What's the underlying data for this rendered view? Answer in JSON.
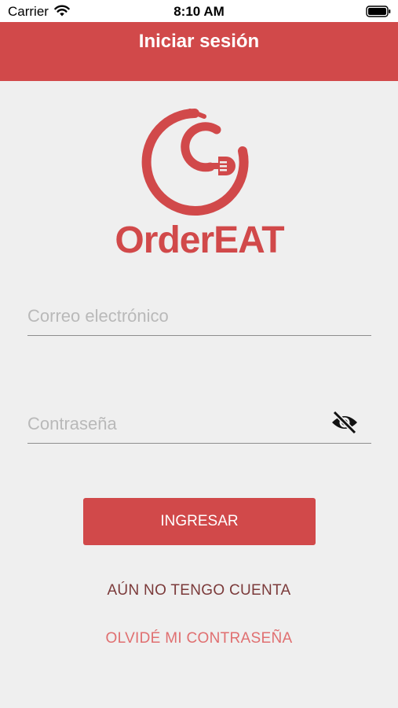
{
  "status_bar": {
    "carrier": "Carrier",
    "time": "8:10 AM",
    "icons": [
      "wifi-icon",
      "battery-icon"
    ]
  },
  "nav": {
    "title": "Iniciar sesión"
  },
  "logo": {
    "text": "OrderEAT",
    "icon": "fork-spiral-logo"
  },
  "form": {
    "email": {
      "value": "",
      "placeholder": "Correo electrónico"
    },
    "password": {
      "value": "",
      "placeholder": "Contraseña",
      "toggle_icon": "eye-off-icon"
    }
  },
  "actions": {
    "login_label": "INGRESAR",
    "register_label": "AÚN NO TENGO CUENTA",
    "forgot_label": "OLVIDÉ MI CONTRASEÑA"
  },
  "colors": {
    "brand": "#d1494a",
    "background": "#efefef",
    "link_dark": "#7b3a3a",
    "link_light": "#e06f70"
  }
}
